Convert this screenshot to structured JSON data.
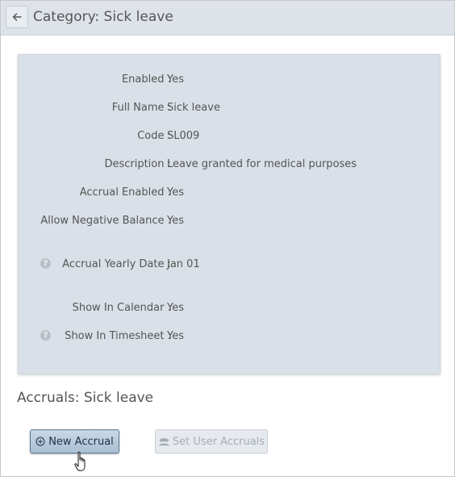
{
  "header": {
    "title": "Category: Sick leave"
  },
  "details": {
    "enabled_label": "Enabled :",
    "enabled_value": "Yes",
    "fullname_label": "Full Name :",
    "fullname_value": "Sick leave",
    "code_label": "Code :",
    "code_value": "SL009",
    "description_label": "Description :",
    "description_value": "Leave granted for medical purposes",
    "accrual_enabled_label": "Accrual Enabled :",
    "accrual_enabled_value": "Yes",
    "allow_negative_label": "Allow Negative Balance :",
    "allow_negative_value": "Yes",
    "accrual_yearly_label": "Accrual Yearly Date :",
    "accrual_yearly_value": "Jan 01",
    "show_calendar_label": "Show In Calendar :",
    "show_calendar_value": "Yes",
    "show_timesheet_label": "Show In Timesheet :",
    "show_timesheet_value": "Yes",
    "help_glyph": "?"
  },
  "accruals": {
    "title": "Accruals: Sick leave",
    "new_accrual_label": "New Accrual",
    "set_user_accruals_label": "Set User Accruals"
  },
  "icons": {
    "back": "arrow-left-icon",
    "help": "question-circle-icon",
    "add": "plus-circle-icon",
    "users": "users-icon",
    "cursor": "hand-pointer-icon"
  }
}
